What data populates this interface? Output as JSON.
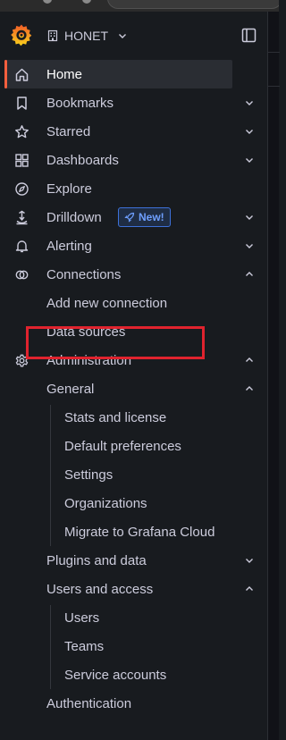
{
  "header": {
    "org_name": "HONET",
    "logo_icon": "grafana-logo-icon",
    "dock_icon": "dock-menu-icon"
  },
  "nav": {
    "home": "Home",
    "bookmarks": "Bookmarks",
    "starred": "Starred",
    "dashboards": "Dashboards",
    "explore": "Explore",
    "drilldown": "Drilldown",
    "drilldown_badge": "New!",
    "alerting": "Alerting",
    "connections": "Connections",
    "add_new_connection": "Add new connection",
    "data_sources": "Data sources",
    "administration": "Administration",
    "general": "General",
    "stats_and_license": "Stats and license",
    "default_preferences": "Default preferences",
    "settings": "Settings",
    "organizations": "Organizations",
    "migrate_to_grafana_cloud": "Migrate to Grafana Cloud",
    "plugins_and_data": "Plugins and data",
    "users_and_access": "Users and access",
    "users": "Users",
    "teams": "Teams",
    "service_accounts": "Service accounts",
    "authentication": "Authentication"
  },
  "colors": {
    "accent": "#f55f3e",
    "highlight_box": "#e0232e",
    "badge": "#6e9fff"
  }
}
